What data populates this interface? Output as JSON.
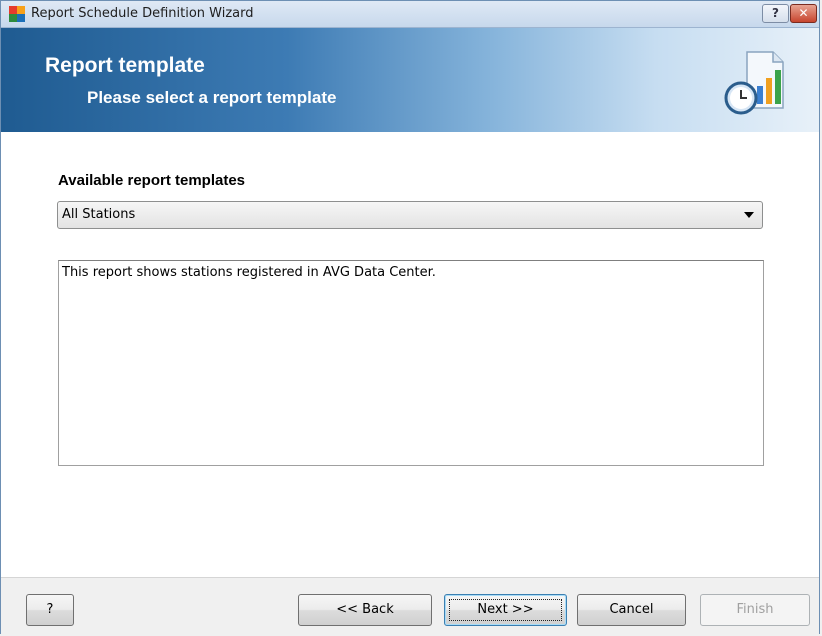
{
  "window": {
    "title": "Report Schedule Definition Wizard",
    "help_glyph": "?",
    "close_glyph": "✕"
  },
  "banner": {
    "title": "Report template",
    "subtitle": "Please select a report template",
    "icon": "report-schedule-icon"
  },
  "form": {
    "templates_label": "Available report templates",
    "selected_template": "All Stations",
    "description": "This report shows stations registered in AVG Data Center."
  },
  "buttons": {
    "help": "?",
    "back": "<< Back",
    "next": "Next >>",
    "cancel": "Cancel",
    "finish": "Finish"
  },
  "colors": {
    "banner_start": "#1f5b91",
    "banner_end": "#e8f1f9",
    "close_button": "#c7452e"
  }
}
